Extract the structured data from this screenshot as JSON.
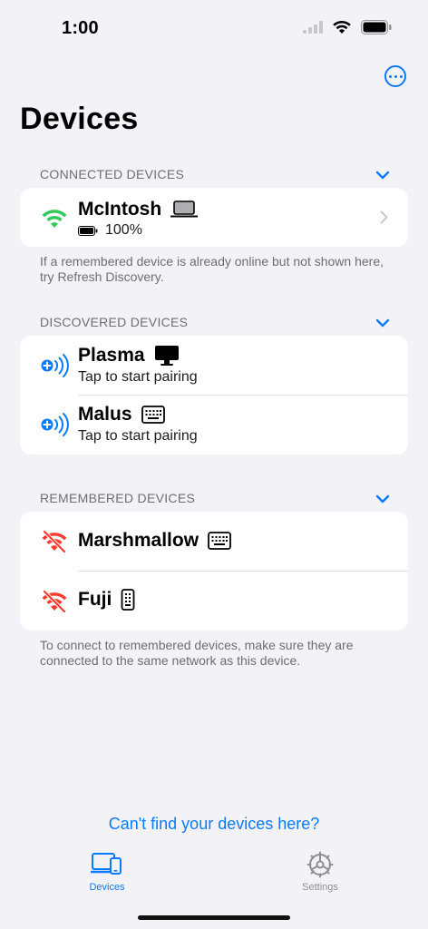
{
  "status_bar": {
    "time": "1:00"
  },
  "page_title": "Devices",
  "sections": {
    "connected": {
      "header": "CONNECTED DEVICES",
      "devices": [
        {
          "name": "McIntosh",
          "detail": "100%",
          "type_icon": "laptop-icon",
          "status_icon": "wifi-icon"
        }
      ],
      "footer": "If a remembered device is already online but not shown here, try Refresh Discovery."
    },
    "discovered": {
      "header": "DISCOVERED DEVICES",
      "devices": [
        {
          "name": "Plasma",
          "detail": "Tap to start pairing",
          "type_icon": "desktop-icon",
          "status_icon": "pair-icon"
        },
        {
          "name": "Malus",
          "detail": "Tap to start pairing",
          "type_icon": "keyboard-icon",
          "status_icon": "pair-icon"
        }
      ]
    },
    "remembered": {
      "header": "REMEMBERED DEVICES",
      "devices": [
        {
          "name": "Marshmallow",
          "type_icon": "keyboard-icon",
          "status_icon": "wifi-off-icon"
        },
        {
          "name": "Fuji",
          "type_icon": "phone-icon",
          "status_icon": "wifi-off-icon"
        }
      ],
      "footer": "To connect to remembered devices, make sure they are connected to the same network as this device."
    }
  },
  "help_link": "Can't find your devices here?",
  "tabs": [
    {
      "label": "Devices",
      "icon": "devices-icon",
      "selected": true
    },
    {
      "label": "Settings",
      "icon": "gear-icon",
      "selected": false
    }
  ],
  "colors": {
    "accent": "#0a7bff",
    "connected": "#34c759",
    "offline": "#ff3b30",
    "background": "#f2f2f7"
  }
}
